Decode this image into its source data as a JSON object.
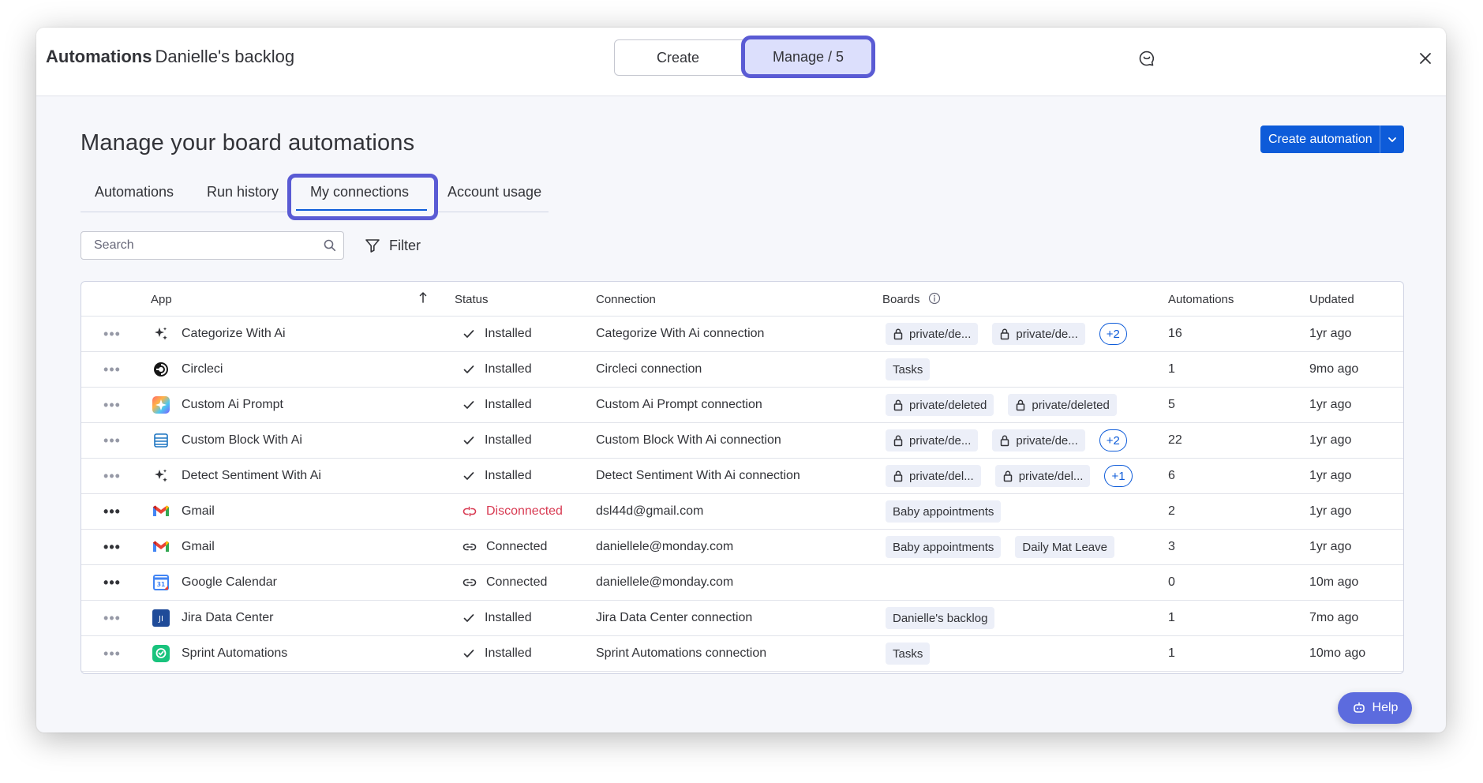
{
  "header": {
    "title_bold": "Automations",
    "title_board": "Danielle's backlog",
    "create_tab": "Create",
    "manage_tab": "Manage / 5"
  },
  "page": {
    "title": "Manage your board automations",
    "create_button": "Create automation"
  },
  "tabs": [
    {
      "label": "Automations",
      "active": false
    },
    {
      "label": "Run history",
      "active": false
    },
    {
      "label": "My connections",
      "active": true
    },
    {
      "label": "Account usage",
      "active": false
    }
  ],
  "search": {
    "placeholder": "Search",
    "value": ""
  },
  "filter_label": "Filter",
  "table": {
    "headers": {
      "app": "App",
      "status": "Status",
      "connection": "Connection",
      "boards": "Boards",
      "automations": "Automations",
      "updated": "Updated"
    },
    "sort": "app-ascending",
    "rows": [
      {
        "app": "Categorize With Ai",
        "icon": "sparkle-icon",
        "status": "Installed",
        "status_type": "installed",
        "connection": "Categorize With Ai connection",
        "boards": [
          {
            "label": "private/de...",
            "locked": true
          },
          {
            "label": "private/de...",
            "locked": true
          }
        ],
        "more": "+2",
        "automations": "16",
        "updated": "1yr ago"
      },
      {
        "app": "Circleci",
        "icon": "circleci-icon",
        "status": "Installed",
        "status_type": "installed",
        "connection": "Circleci connection",
        "boards": [
          {
            "label": "Tasks",
            "locked": false
          }
        ],
        "more": "",
        "automations": "1",
        "updated": "9mo ago"
      },
      {
        "app": "Custom Ai Prompt",
        "icon": "custom-ai-prompt-icon",
        "status": "Installed",
        "status_type": "installed",
        "connection": "Custom Ai Prompt connection",
        "boards": [
          {
            "label": "private/deleted",
            "locked": true
          },
          {
            "label": "private/deleted",
            "locked": true
          }
        ],
        "more": "",
        "automations": "5",
        "updated": "1yr ago"
      },
      {
        "app": "Custom Block With Ai",
        "icon": "custom-block-icon",
        "status": "Installed",
        "status_type": "installed",
        "connection": "Custom Block With Ai connection",
        "boards": [
          {
            "label": "private/de...",
            "locked": true
          },
          {
            "label": "private/de...",
            "locked": true
          }
        ],
        "more": "+2",
        "automations": "22",
        "updated": "1yr ago"
      },
      {
        "app": "Detect Sentiment With Ai",
        "icon": "sparkle-icon",
        "status": "Installed",
        "status_type": "installed",
        "connection": "Detect Sentiment With Ai connection",
        "boards": [
          {
            "label": "private/del...",
            "locked": true
          },
          {
            "label": "private/del...",
            "locked": true
          }
        ],
        "more": "+1",
        "automations": "6",
        "updated": "1yr ago"
      },
      {
        "app": "Gmail",
        "icon": "gmail-icon",
        "status": "Disconnected",
        "status_type": "disconnected",
        "connection": "dsl44d@gmail.com",
        "boards": [
          {
            "label": "Baby appointments",
            "locked": false
          }
        ],
        "more": "",
        "automations": "2",
        "updated": "1yr ago"
      },
      {
        "app": "Gmail",
        "icon": "gmail-icon",
        "status": "Connected",
        "status_type": "connected",
        "connection": "daniellele@monday.com",
        "boards": [
          {
            "label": "Baby appointments",
            "locked": false
          },
          {
            "label": "Daily Mat Leave",
            "locked": false
          }
        ],
        "more": "",
        "automations": "3",
        "updated": "1yr ago"
      },
      {
        "app": "Google Calendar",
        "icon": "google-calendar-icon",
        "status": "Connected",
        "status_type": "connected",
        "connection": "daniellele@monday.com",
        "boards": [],
        "more": "",
        "automations": "0",
        "updated": "10m ago"
      },
      {
        "app": "Jira Data Center",
        "icon": "jira-icon",
        "status": "Installed",
        "status_type": "installed",
        "connection": "Jira Data Center connection",
        "boards": [
          {
            "label": "Danielle's backlog",
            "locked": false
          }
        ],
        "more": "",
        "automations": "1",
        "updated": "7mo ago"
      },
      {
        "app": "Sprint Automations",
        "icon": "sprint-automations-icon",
        "status": "Installed",
        "status_type": "installed",
        "connection": "Sprint Automations connection",
        "boards": [
          {
            "label": "Tasks",
            "locked": false
          }
        ],
        "more": "",
        "automations": "1",
        "updated": "10mo ago"
      }
    ]
  },
  "help_label": "Help",
  "colors": {
    "primary": "#0d5bd9",
    "highlight": "#5a5bd4",
    "disconnected": "#d83a52",
    "chip_bg": "#eceff8"
  }
}
